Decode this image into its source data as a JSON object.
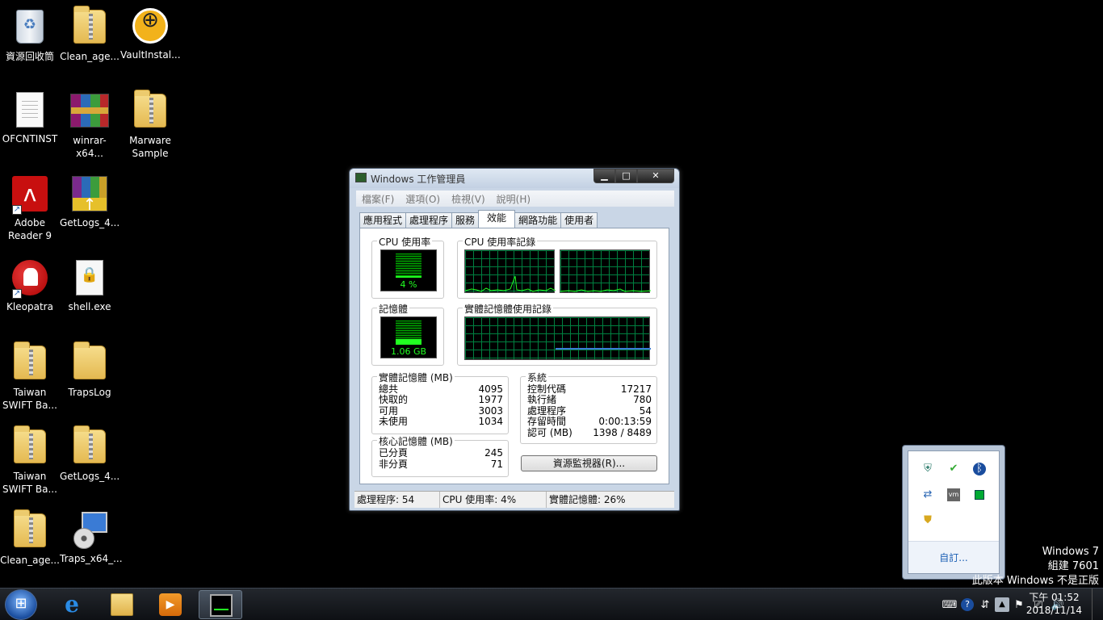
{
  "desktop": {
    "icons": [
      {
        "label": "資源回收筒"
      },
      {
        "label": "Clean_age..."
      },
      {
        "label": "VaultInstal..."
      },
      {
        "label": "OFCNTINST"
      },
      {
        "label": "winrar-x64..."
      },
      {
        "label": "Marware\nSample"
      },
      {
        "label": "Adobe\nReader 9"
      },
      {
        "label": "GetLogs_4..."
      },
      {
        "label": "Kleopatra"
      },
      {
        "label": "shell.exe"
      },
      {
        "label": "Taiwan\nSWIFT Ba..."
      },
      {
        "label": "TrapsLog"
      },
      {
        "label": "Taiwan\nSWIFT Ba..."
      },
      {
        "label": "GetLogs_4..."
      },
      {
        "label": "Clean_age..."
      },
      {
        "label": "Traps_x64_..."
      }
    ]
  },
  "taskmgr": {
    "title": "Windows 工作管理員",
    "window_buttons": {
      "min": "▁",
      "max": "□",
      "close": "✕"
    },
    "menu": [
      "檔案(F)",
      "選項(O)",
      "檢視(V)",
      "說明(H)"
    ],
    "tabs": [
      "應用程式",
      "處理程序",
      "服務",
      "效能",
      "網路功能",
      "使用者"
    ],
    "active_tab": "效能",
    "cpu_usage": {
      "title": "CPU 使用率",
      "value": "4 %",
      "level": 0.04
    },
    "cpu_history_title": "CPU 使用率記錄",
    "memory": {
      "title": "記憶體",
      "value": "1.06 GB",
      "level": 0.26
    },
    "memory_history_title": "實體記憶體使用記錄",
    "physical_memory": {
      "title": "實體記憶體 (MB)",
      "rows": [
        {
          "k": "總共",
          "v": "4095"
        },
        {
          "k": "快取的",
          "v": "1977"
        },
        {
          "k": "可用",
          "v": "3003"
        },
        {
          "k": "未使用",
          "v": "1034"
        }
      ]
    },
    "kernel_memory": {
      "title": "核心記憶體 (MB)",
      "rows": [
        {
          "k": "已分頁",
          "v": "245"
        },
        {
          "k": "非分頁",
          "v": "71"
        }
      ]
    },
    "system": {
      "title": "系統",
      "rows": [
        {
          "k": "控制代碼",
          "v": "17217"
        },
        {
          "k": "執行緒",
          "v": "780"
        },
        {
          "k": "處理程序",
          "v": "54"
        },
        {
          "k": "存留時間",
          "v": "0:00:13:59"
        },
        {
          "k": "認可 (MB)",
          "v": "1398 / 8489"
        }
      ]
    },
    "resource_monitor_button": "資源監視器(R)...",
    "status": {
      "processes": "處理程序: 54",
      "cpu": "CPU 使用率: 4%",
      "memory": "實體記憶體: 26%"
    },
    "colors": {
      "graph_line": "#22ff22",
      "memory_line": "#3a7bd5",
      "grid": "#008040"
    }
  },
  "tray_popup": {
    "icons": [
      "shield-icon",
      "usb-safe-remove-icon",
      "bluetooth-icon",
      "network-share-icon",
      "vmware-icon",
      "green-square-icon",
      "traps-shield-icon"
    ],
    "customize": "自訂..."
  },
  "watermark": {
    "line1": "Windows 7",
    "line2": "組建 7601",
    "line3": "此版本 Windows 不是正版"
  },
  "taskbar": {
    "clock_time": "下午 01:52",
    "clock_date": "2018/11/14",
    "pinned": [
      "internet-explorer-icon",
      "windows-explorer-icon",
      "media-player-icon",
      "task-manager-icon"
    ]
  }
}
